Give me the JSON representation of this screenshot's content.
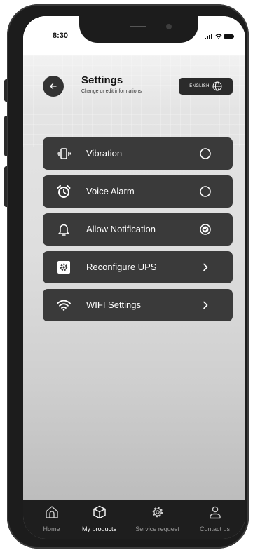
{
  "status_bar": {
    "time": "8:30"
  },
  "header": {
    "title": "Settings",
    "subtitle": "Change or edit informations",
    "language_label": "ENGLISH"
  },
  "menu": [
    {
      "label": "Vibration",
      "icon": "vibration-icon",
      "trailing": "radio-unchecked"
    },
    {
      "label": "Voice Alarm",
      "icon": "alarm-clock-icon",
      "trailing": "radio-unchecked"
    },
    {
      "label": "Allow Notification",
      "icon": "bell-icon",
      "trailing": "radio-checked"
    },
    {
      "label": "Reconfigure UPS",
      "icon": "settings-box-icon",
      "trailing": "chevron-right"
    },
    {
      "label": "WIFI Settings",
      "icon": "wifi-icon",
      "trailing": "chevron-right"
    }
  ],
  "bottom_nav": [
    {
      "label": "Home",
      "icon": "home-icon",
      "active": false
    },
    {
      "label": "My products",
      "icon": "cube-icon",
      "active": true
    },
    {
      "label": "Service request",
      "icon": "gear-icon",
      "active": false
    },
    {
      "label": "Contact us",
      "icon": "person-icon",
      "active": false
    }
  ],
  "colors": {
    "item_bg": "#3a3a3a",
    "nav_bg": "#1e1e1e",
    "frame": "#1c1c1c"
  }
}
